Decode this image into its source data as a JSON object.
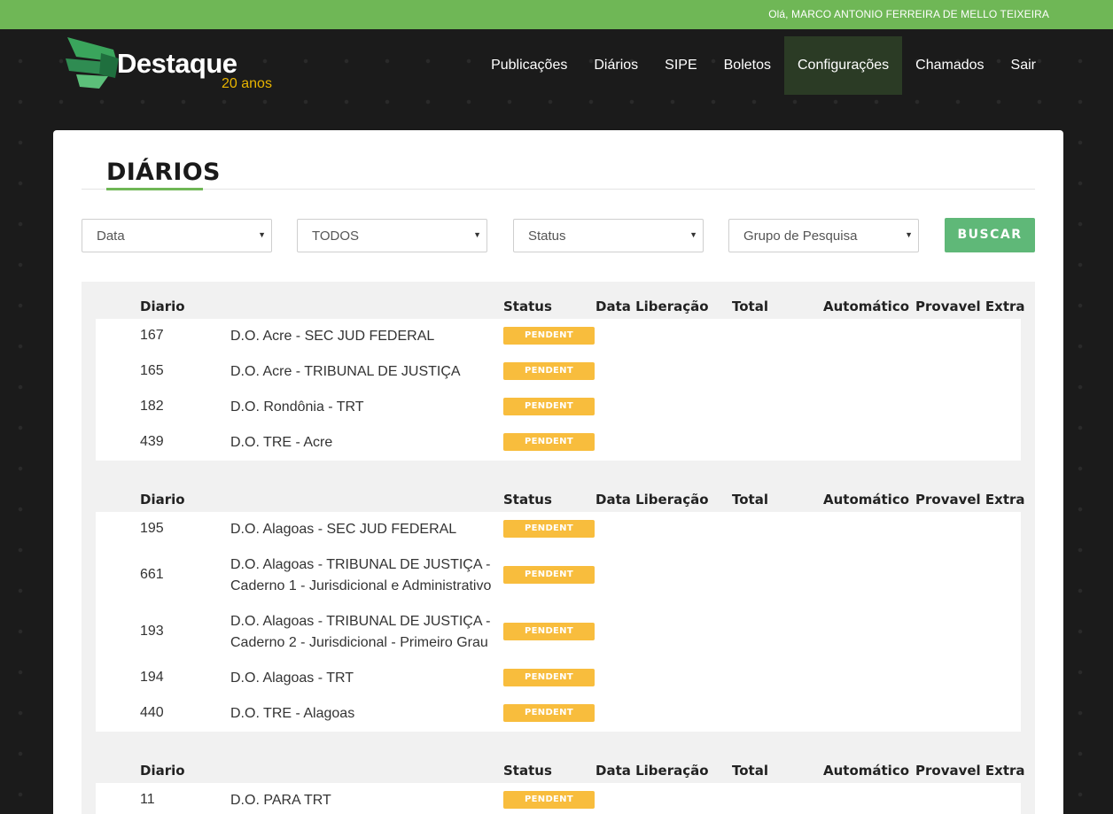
{
  "topbar": {
    "greeting": "Olá, MARCO ANTONIO FERREIRA DE MELLO TEIXEIRA"
  },
  "brand": {
    "name": "Destaque",
    "tagline": "20 anos",
    "accent": "#6fb756",
    "tagline_color": "#e8b400"
  },
  "nav": {
    "items": [
      {
        "label": "Publicações"
      },
      {
        "label": "Diários"
      },
      {
        "label": "SIPE"
      },
      {
        "label": "Boletos"
      },
      {
        "label": "Configurações",
        "active": true
      },
      {
        "label": "Chamados"
      },
      {
        "label": "Sair"
      }
    ]
  },
  "page": {
    "title": "DIÁRIOS"
  },
  "filters": {
    "date": "Data",
    "type": "TODOS",
    "status": "Status",
    "group": "Grupo de Pesquisa",
    "search_label": "BUSCAR"
  },
  "table": {
    "headers": {
      "diario": "Diario",
      "status": "Status",
      "data_liberacao": "Data Liberação",
      "total": "Total",
      "automatico": "Automático",
      "provavel_extra": "Provavel Extra"
    },
    "groups": [
      {
        "rows": [
          {
            "id": "167",
            "name": "D.O. Acre - SEC JUD FEDERAL",
            "status": "PENDENT"
          },
          {
            "id": "165",
            "name": "D.O. Acre - TRIBUNAL DE JUSTIÇA",
            "status": "PENDENT"
          },
          {
            "id": "182",
            "name": "D.O. Rondônia - TRT",
            "status": "PENDENT"
          },
          {
            "id": "439",
            "name": "D.O. TRE - Acre",
            "status": "PENDENT"
          }
        ]
      },
      {
        "rows": [
          {
            "id": "195",
            "name": "D.O. Alagoas - SEC JUD FEDERAL",
            "status": "PENDENT"
          },
          {
            "id": "661",
            "name": "D.O. Alagoas - TRIBUNAL DE JUSTIÇA - Caderno 1 - Jurisdicional e Administrativo",
            "status": "PENDENT"
          },
          {
            "id": "193",
            "name": "D.O. Alagoas - TRIBUNAL DE JUSTIÇA - Caderno 2 - Jurisdicional - Primeiro Grau",
            "status": "PENDENT"
          },
          {
            "id": "194",
            "name": "D.O. Alagoas - TRT",
            "status": "PENDENT"
          },
          {
            "id": "440",
            "name": "D.O. TRE - Alagoas",
            "status": "PENDENT"
          }
        ]
      },
      {
        "rows": [
          {
            "id": "11",
            "name": "D.O. PARA TRT",
            "status": "PENDENT"
          }
        ]
      }
    ]
  },
  "colors": {
    "pending": "#f8bd3d",
    "button": "#5fb878",
    "topbar": "#6fb756"
  }
}
